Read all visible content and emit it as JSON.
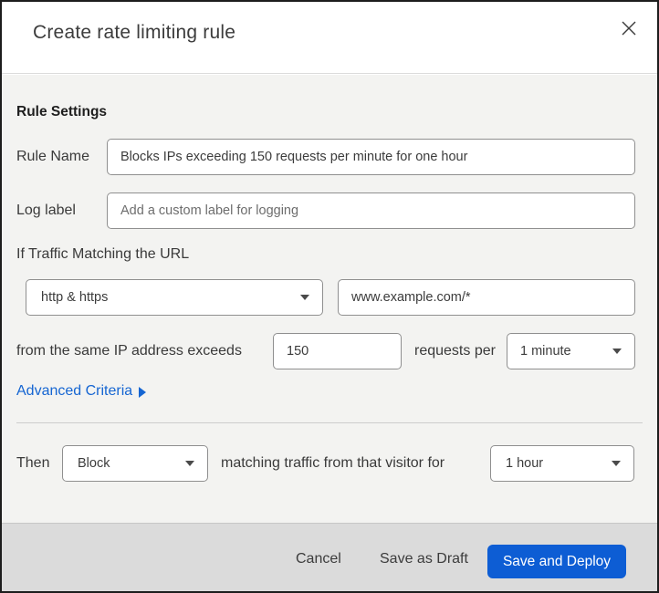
{
  "dialog": {
    "title": "Create rate limiting rule"
  },
  "rule_settings": {
    "heading": "Rule Settings",
    "rule_name": {
      "label": "Rule Name",
      "value": "Blocks IPs exceeding 150 requests per minute for one hour"
    },
    "log_label": {
      "label": "Log label",
      "placeholder": "Add a custom label for logging"
    }
  },
  "match": {
    "heading": "If Traffic Matching the URL",
    "scheme_selected": "http & https",
    "url_value": "www.example.com/*",
    "threshold_prefix": "from the same IP address exceeds",
    "threshold_value": "150",
    "threshold_suffix": "requests per",
    "period_selected": "1 minute",
    "advanced_link": "Advanced Criteria"
  },
  "action": {
    "then_label": "Then",
    "action_selected": "Block",
    "suffix": "matching traffic from that visitor for",
    "duration_selected": "1 hour"
  },
  "footer": {
    "cancel": "Cancel",
    "save_draft": "Save as Draft",
    "save_deploy": "Save and Deploy"
  },
  "colors": {
    "primary_button_blue": "#0d5dd4",
    "link_blue": "#1565d2",
    "body_background": "#f3f3f1",
    "footer_background": "#dbdbdb",
    "input_border": "#8f8f8f",
    "top_strip_navy": "#0b1c2b"
  }
}
